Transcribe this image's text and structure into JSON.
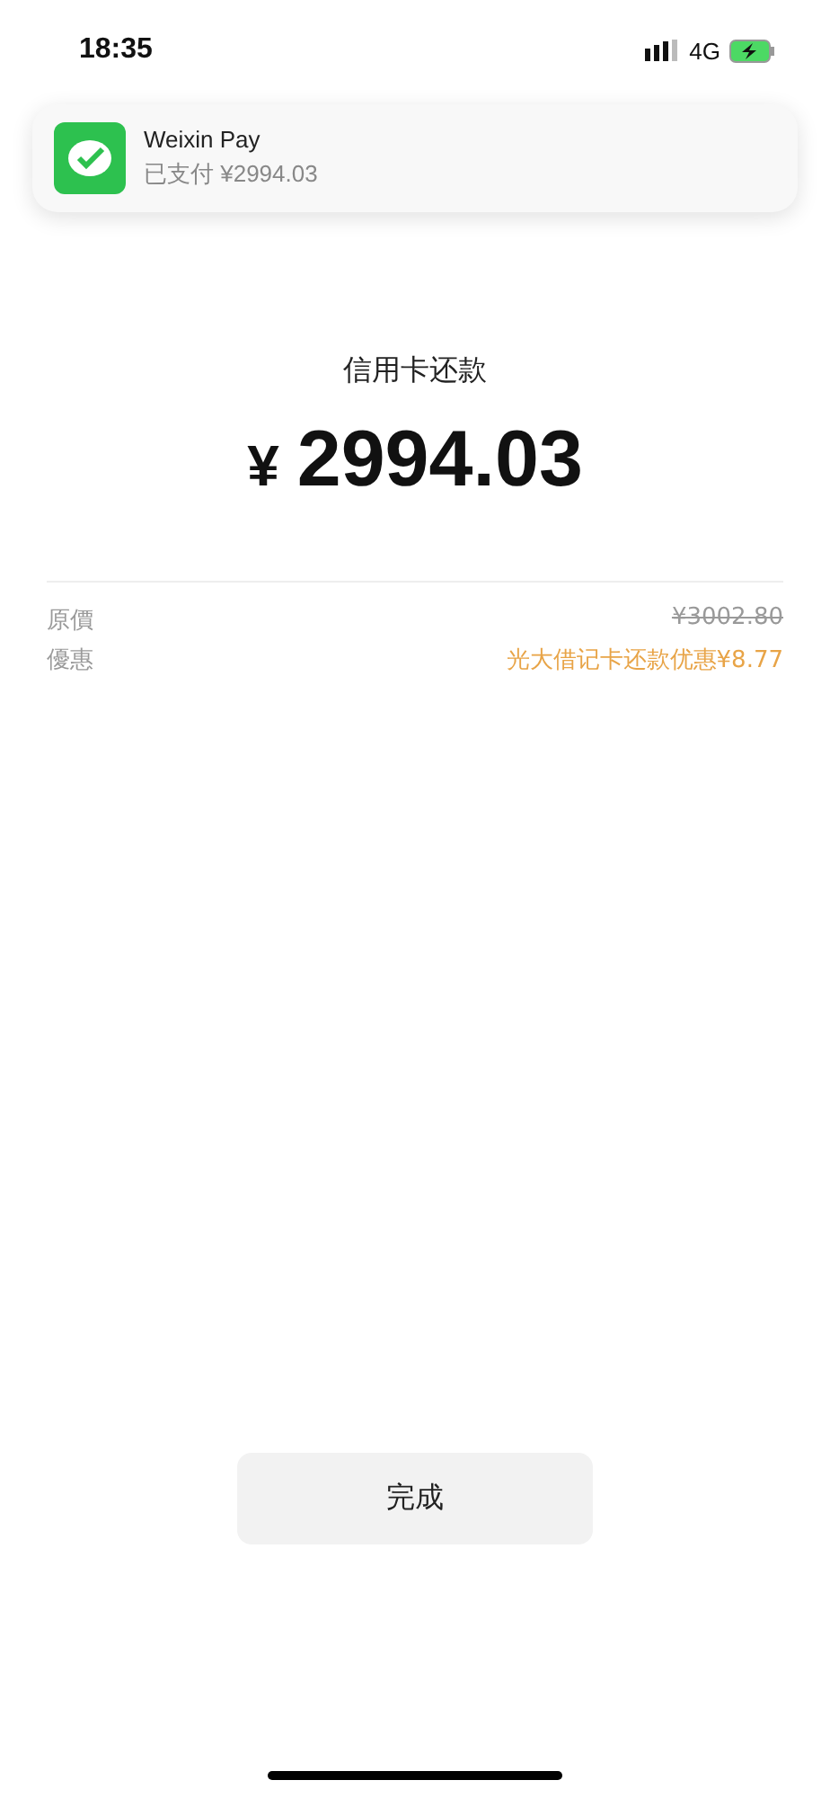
{
  "status_bar": {
    "time": "18:35",
    "network": "4G"
  },
  "notification": {
    "app": "Weixin Pay",
    "message": "已支付 ¥2994.03"
  },
  "payment": {
    "title": "信用卡还款",
    "currency": "¥",
    "amount": "2994.03"
  },
  "details": [
    {
      "label": "原價",
      "value": "¥3002.80",
      "kind": "struck"
    },
    {
      "label": "優惠",
      "value": "光大借记卡还款优惠¥8.77",
      "kind": "discount"
    }
  ],
  "done_button": "完成"
}
